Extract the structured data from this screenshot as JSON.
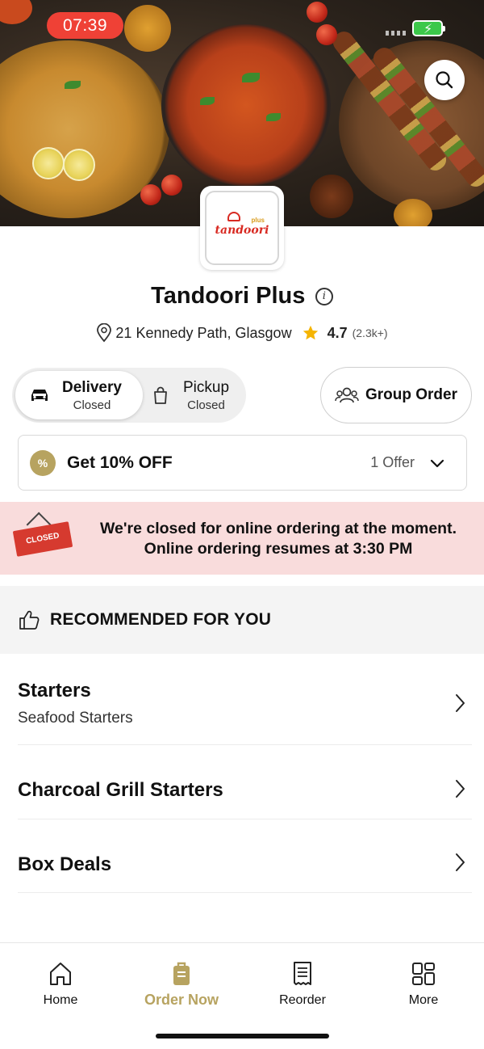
{
  "status_bar": {
    "time": "07:39"
  },
  "restaurant": {
    "logo_text": "tandoori",
    "logo_plus": "plus",
    "name": "Tandoori Plus",
    "address": "21 Kennedy Path, Glasgow",
    "rating": "4.7",
    "rating_count": "(2.3k+)"
  },
  "order_mode": {
    "delivery": {
      "label": "Delivery",
      "status": "Closed",
      "selected": true
    },
    "pickup": {
      "label": "Pickup",
      "status": "Closed",
      "selected": false
    },
    "group_order_label": "Group Order"
  },
  "offer": {
    "badge": "%",
    "title": "Get 10% OFF",
    "count_label": "1 Offer"
  },
  "closed_notice": {
    "sign_text": "CLOSED",
    "line1": "We're closed for online ordering at the moment.",
    "line2": "Online ordering resumes at 3:30 PM"
  },
  "recommended": {
    "label": "RECOMMENDED FOR YOU"
  },
  "categories": [
    {
      "title": "Starters",
      "subtitle": "Seafood Starters"
    },
    {
      "title": "Charcoal Grill Starters",
      "subtitle": ""
    },
    {
      "title": "Box Deals",
      "subtitle": ""
    }
  ],
  "bottom_nav": [
    {
      "label": "Home",
      "icon": "home-icon",
      "active": false
    },
    {
      "label": "Order Now",
      "icon": "order-bag-icon",
      "active": true
    },
    {
      "label": "Reorder",
      "icon": "receipt-icon",
      "active": false
    },
    {
      "label": "More",
      "icon": "grid-icon",
      "active": false
    }
  ],
  "colors": {
    "accent": "#b7a360",
    "closed_banner": "#f9dcdc",
    "time_pill": "#ef4136",
    "star": "#f5b400"
  }
}
